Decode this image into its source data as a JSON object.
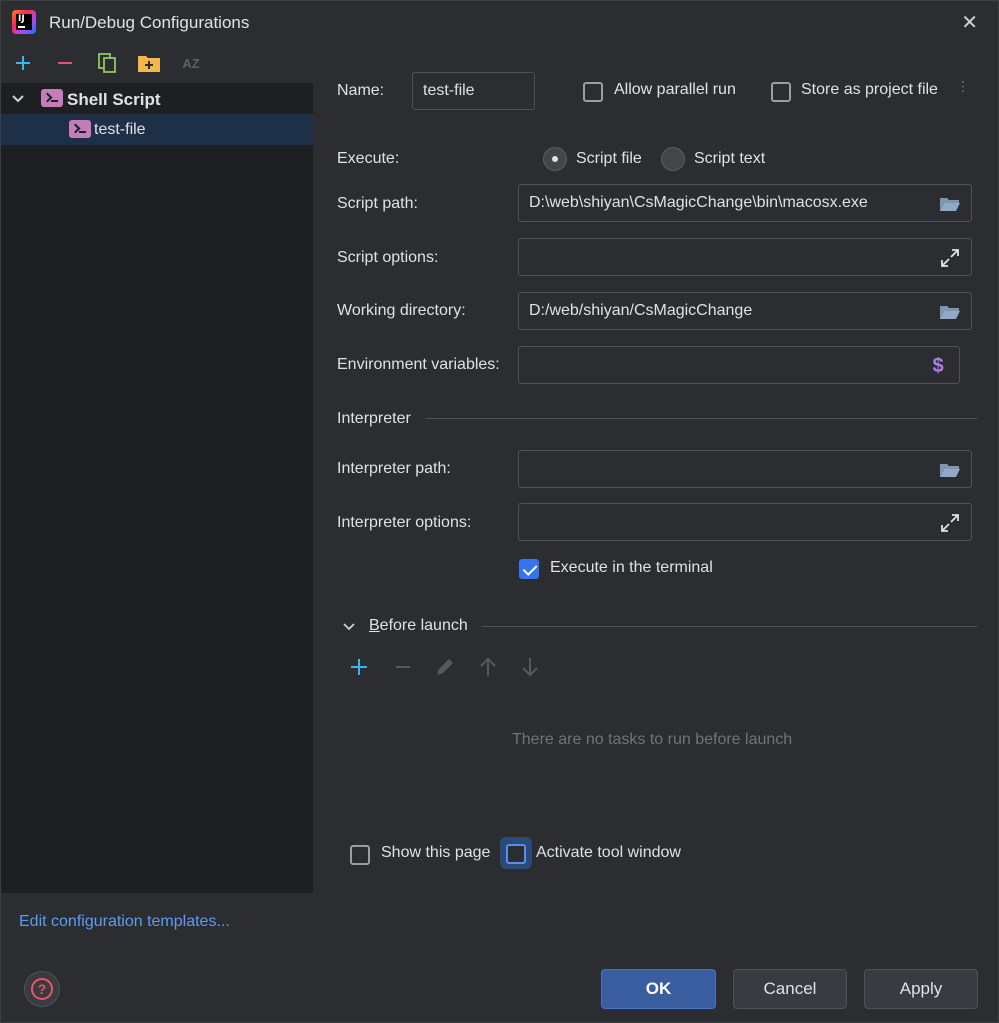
{
  "window": {
    "title": "Run/Debug Configurations"
  },
  "tree": {
    "group_label": "Shell Script",
    "item_label": "test-file"
  },
  "edit_templates_label": "Edit configuration templates...",
  "form": {
    "name_label": "Name:",
    "name_value": "test-file",
    "allow_parallel_label": "Allow parallel run",
    "store_project_label": "Store as project file",
    "execute_label": "Execute:",
    "script_file_label": "Script file",
    "script_text_label": "Script text",
    "script_path_label": "Script path:",
    "script_path_value": "D:\\web\\shiyan\\CsMagicChange\\bin\\macosx.exe",
    "script_options_label": "Script options:",
    "script_options_value": "",
    "working_dir_label": "Working directory:",
    "working_dir_value": "D:/web/shiyan/CsMagicChange",
    "env_vars_label": "Environment variables:",
    "env_vars_value": "",
    "interpreter_section": "Interpreter",
    "interpreter_path_label": "Interpreter path:",
    "interpreter_path_value": "",
    "interpreter_options_label": "Interpreter options:",
    "interpreter_options_value": "",
    "execute_terminal_label": "Execute in the terminal",
    "execute_terminal_checked": true
  },
  "before_launch": {
    "title": "Before launch",
    "empty_text": "There are no tasks to run before launch",
    "show_page_label": "Show this page",
    "activate_tool_label": "Activate tool window"
  },
  "buttons": {
    "ok": "OK",
    "cancel": "Cancel",
    "apply": "Apply"
  },
  "icons": {
    "add": "plus-icon",
    "remove": "minus-icon",
    "copy": "copy-icon",
    "folder": "new-folder-icon",
    "sort": "sort-alpha-icon",
    "browse": "folder-open-icon",
    "expand": "expand-icon",
    "dollar": "dollar-icon",
    "help": "help-icon"
  },
  "colors": {
    "accent": "#3574f0",
    "link": "#5a9cf8",
    "add": "#3ab6e8",
    "remove": "#e55765",
    "help": "#e55765",
    "shell": "#c57dba"
  }
}
